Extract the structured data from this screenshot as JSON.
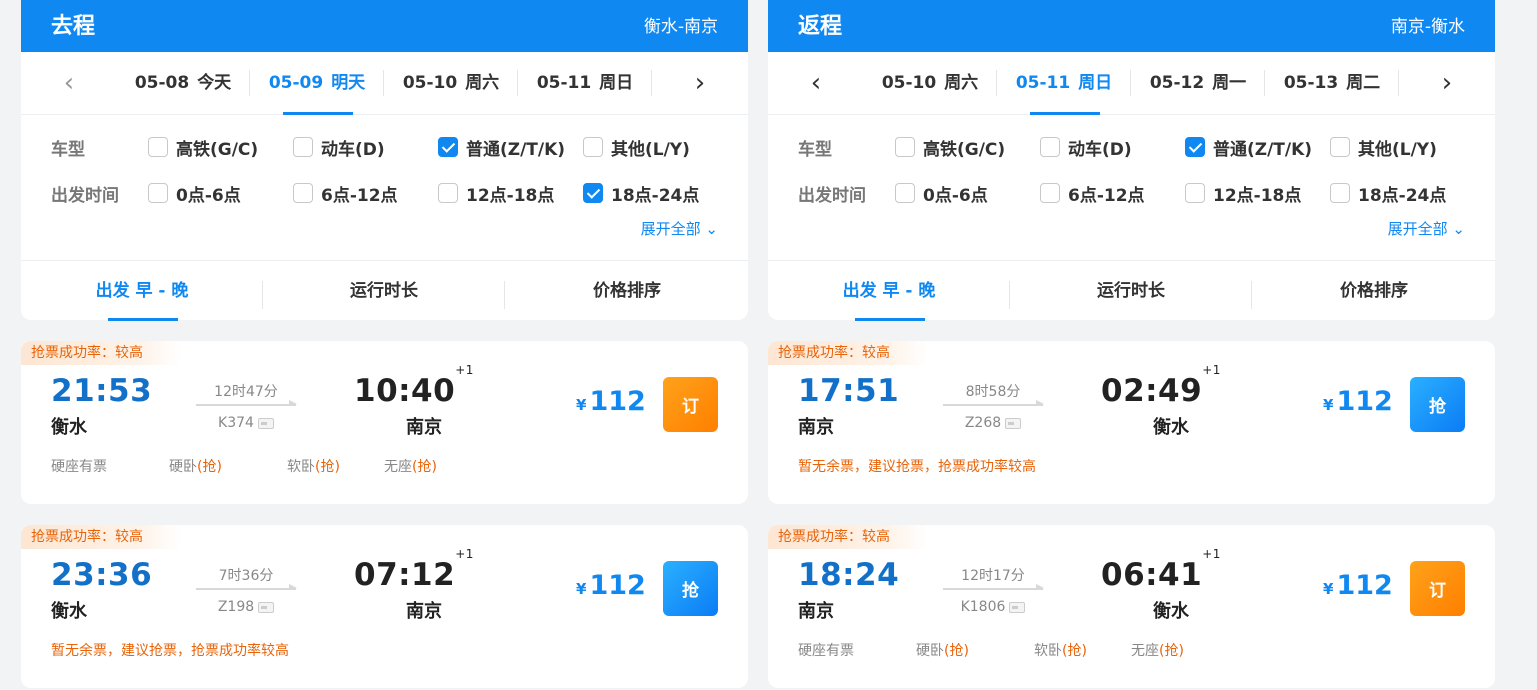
{
  "columns": [
    {
      "title": "去程",
      "route": "衡水-南京",
      "dates": [
        {
          "date": "05-08",
          "day": "今天",
          "active": false
        },
        {
          "date": "05-09",
          "day": "明天",
          "active": true
        },
        {
          "date": "05-10",
          "day": "周六",
          "active": false
        },
        {
          "date": "05-11",
          "day": "周日",
          "active": false
        }
      ],
      "prev_disabled": true,
      "filters": {
        "type_label": "车型",
        "types": [
          {
            "label": "高铁(G/C)",
            "checked": false
          },
          {
            "label": "动车(D)",
            "checked": false
          },
          {
            "label": "普通(Z/T/K)",
            "checked": true
          },
          {
            "label": "其他(L/Y)",
            "checked": false
          }
        ],
        "time_label": "出发时间",
        "times": [
          {
            "label": "0点-6点",
            "checked": false
          },
          {
            "label": "6点-12点",
            "checked": false
          },
          {
            "label": "12点-18点",
            "checked": false
          },
          {
            "label": "18点-24点",
            "checked": true
          }
        ],
        "expand": "展开全部"
      },
      "sort": [
        {
          "label": "出发 早 - 晚",
          "active": true
        },
        {
          "label": "运行时长",
          "active": false
        },
        {
          "label": "价格排序",
          "active": false
        }
      ],
      "trains": [
        {
          "tag": "抢票成功率：较高",
          "dep_time": "21:53",
          "dep_station": "衡水",
          "duration": "12时47分",
          "train_no": "K374",
          "arr_time": "10:40",
          "arr_plus": "+1",
          "arr_station": "南京",
          "currency": "¥",
          "price": "112",
          "btn": "订",
          "btn_color": "#ff8c0a",
          "warn": "",
          "seats": [
            {
              "name": "硬座有票",
              "grab": ""
            },
            {
              "name": "硬卧",
              "grab": "(抢)"
            },
            {
              "name": "软卧",
              "grab": "(抢)"
            },
            {
              "name": "无座",
              "grab": "(抢)"
            }
          ]
        },
        {
          "tag": "抢票成功率：较高",
          "dep_time": "23:36",
          "dep_station": "衡水",
          "duration": "7时36分",
          "train_no": "Z198",
          "arr_time": "07:12",
          "arr_plus": "+1",
          "arr_station": "南京",
          "currency": "¥",
          "price": "112",
          "btn": "抢",
          "btn_color": "#1088f2",
          "warn": "暂无余票，建议抢票，抢票成功率较高",
          "seats": []
        }
      ]
    },
    {
      "title": "返程",
      "route": "南京-衡水",
      "dates": [
        {
          "date": "05-10",
          "day": "周六",
          "active": false
        },
        {
          "date": "05-11",
          "day": "周日",
          "active": true
        },
        {
          "date": "05-12",
          "day": "周一",
          "active": false
        },
        {
          "date": "05-13",
          "day": "周二",
          "active": false
        }
      ],
      "prev_disabled": false,
      "filters": {
        "type_label": "车型",
        "types": [
          {
            "label": "高铁(G/C)",
            "checked": false
          },
          {
            "label": "动车(D)",
            "checked": false
          },
          {
            "label": "普通(Z/T/K)",
            "checked": true
          },
          {
            "label": "其他(L/Y)",
            "checked": false
          }
        ],
        "time_label": "出发时间",
        "times": [
          {
            "label": "0点-6点",
            "checked": false
          },
          {
            "label": "6点-12点",
            "checked": false
          },
          {
            "label": "12点-18点",
            "checked": false
          },
          {
            "label": "18点-24点",
            "checked": false
          }
        ],
        "expand": "展开全部"
      },
      "sort": [
        {
          "label": "出发 早 - 晚",
          "active": true
        },
        {
          "label": "运行时长",
          "active": false
        },
        {
          "label": "价格排序",
          "active": false
        }
      ],
      "trains": [
        {
          "tag": "抢票成功率：较高",
          "dep_time": "17:51",
          "dep_station": "南京",
          "duration": "8时58分",
          "train_no": "Z268",
          "arr_time": "02:49",
          "arr_plus": "+1",
          "arr_station": "衡水",
          "currency": "¥",
          "price": "112",
          "btn": "抢",
          "btn_color": "#1088f2",
          "warn": "暂无余票，建议抢票，抢票成功率较高",
          "seats": []
        },
        {
          "tag": "抢票成功率：较高",
          "dep_time": "18:24",
          "dep_station": "南京",
          "duration": "12时17分",
          "train_no": "K1806",
          "arr_time": "06:41",
          "arr_plus": "+1",
          "arr_station": "衡水",
          "currency": "¥",
          "price": "112",
          "btn": "订",
          "btn_color": "#ff8c0a",
          "warn": "",
          "seats": [
            {
              "name": "硬座有票",
              "grab": ""
            },
            {
              "name": "硬卧",
              "grab": "(抢)"
            },
            {
              "name": "软卧",
              "grab": "(抢)"
            },
            {
              "name": "无座",
              "grab": "(抢)"
            }
          ]
        }
      ]
    }
  ]
}
